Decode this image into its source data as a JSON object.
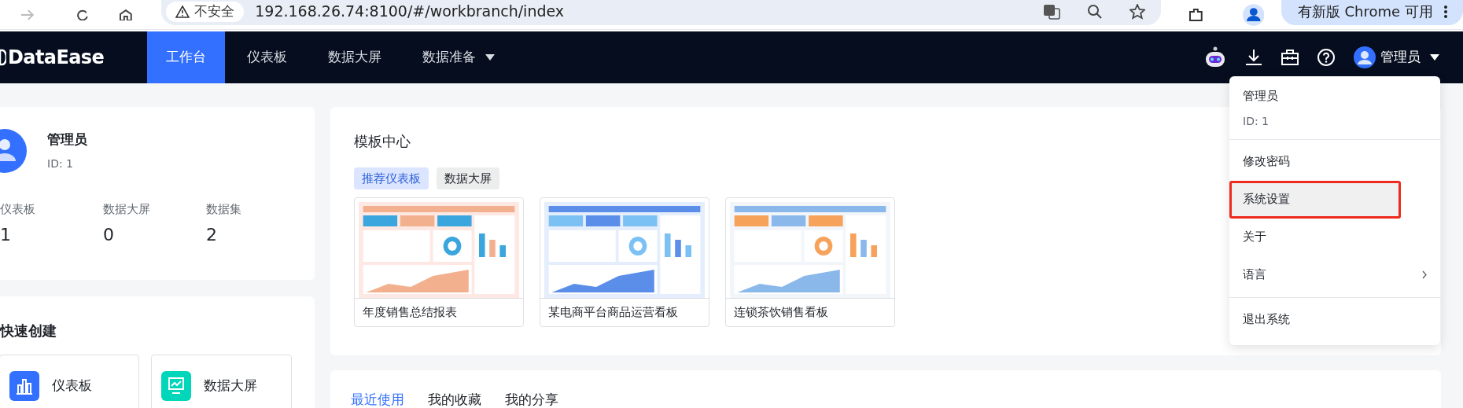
{
  "browser": {
    "security_label": "不安全",
    "url": "192.168.26.74:8100/#/workbranch/index",
    "update_button": "有新版 Chrome 可用"
  },
  "nav": {
    "logo": "DataEase",
    "tabs": [
      {
        "label": "工作台",
        "selected": true,
        "has_menu": false
      },
      {
        "label": "仪表板",
        "selected": false,
        "has_menu": false
      },
      {
        "label": "数据大屏",
        "selected": false,
        "has_menu": false
      },
      {
        "label": "数据准备",
        "selected": false,
        "has_menu": true
      }
    ],
    "user": "管理员"
  },
  "profile": {
    "name": "管理员",
    "id": "ID: 1",
    "stats": [
      {
        "label": "仪表板",
        "value": "1"
      },
      {
        "label": "数据大屏",
        "value": "0"
      },
      {
        "label": "数据集",
        "value": "2"
      }
    ]
  },
  "quick_create": {
    "title": "快速创建",
    "items": [
      {
        "label": "仪表板",
        "kind": "dashboard"
      },
      {
        "label": "数据大屏",
        "kind": "screen"
      }
    ]
  },
  "templates": {
    "title": "模板中心",
    "filters": [
      {
        "label": "推荐仪表板",
        "selected": true
      },
      {
        "label": "数据大屏",
        "selected": false
      }
    ],
    "cards": [
      {
        "title": "年度销售总结报表",
        "kind": "picture"
      },
      {
        "title": "某电商平台商品运营看板",
        "kind": "picture"
      },
      {
        "title": "连锁茶饮销售看板",
        "kind": "picture"
      }
    ]
  },
  "recent": {
    "tabs": [
      {
        "label": "最近使用",
        "selected": true
      },
      {
        "label": "我的收藏",
        "selected": false
      },
      {
        "label": "我的分享",
        "selected": false
      }
    ]
  },
  "user_menu": {
    "name": "管理员",
    "id": "ID: 1",
    "groups": [
      [
        {
          "label": "修改密码",
          "highlighted": false,
          "has_submenu": false
        },
        {
          "label": "系统设置",
          "highlighted": true,
          "has_submenu": false
        },
        {
          "label": "关于",
          "highlighted": false,
          "has_submenu": false
        },
        {
          "label": "语言",
          "highlighted": false,
          "has_submenu": true
        }
      ],
      [
        {
          "label": "退出系统",
          "highlighted": false,
          "has_submenu": false
        }
      ]
    ]
  }
}
